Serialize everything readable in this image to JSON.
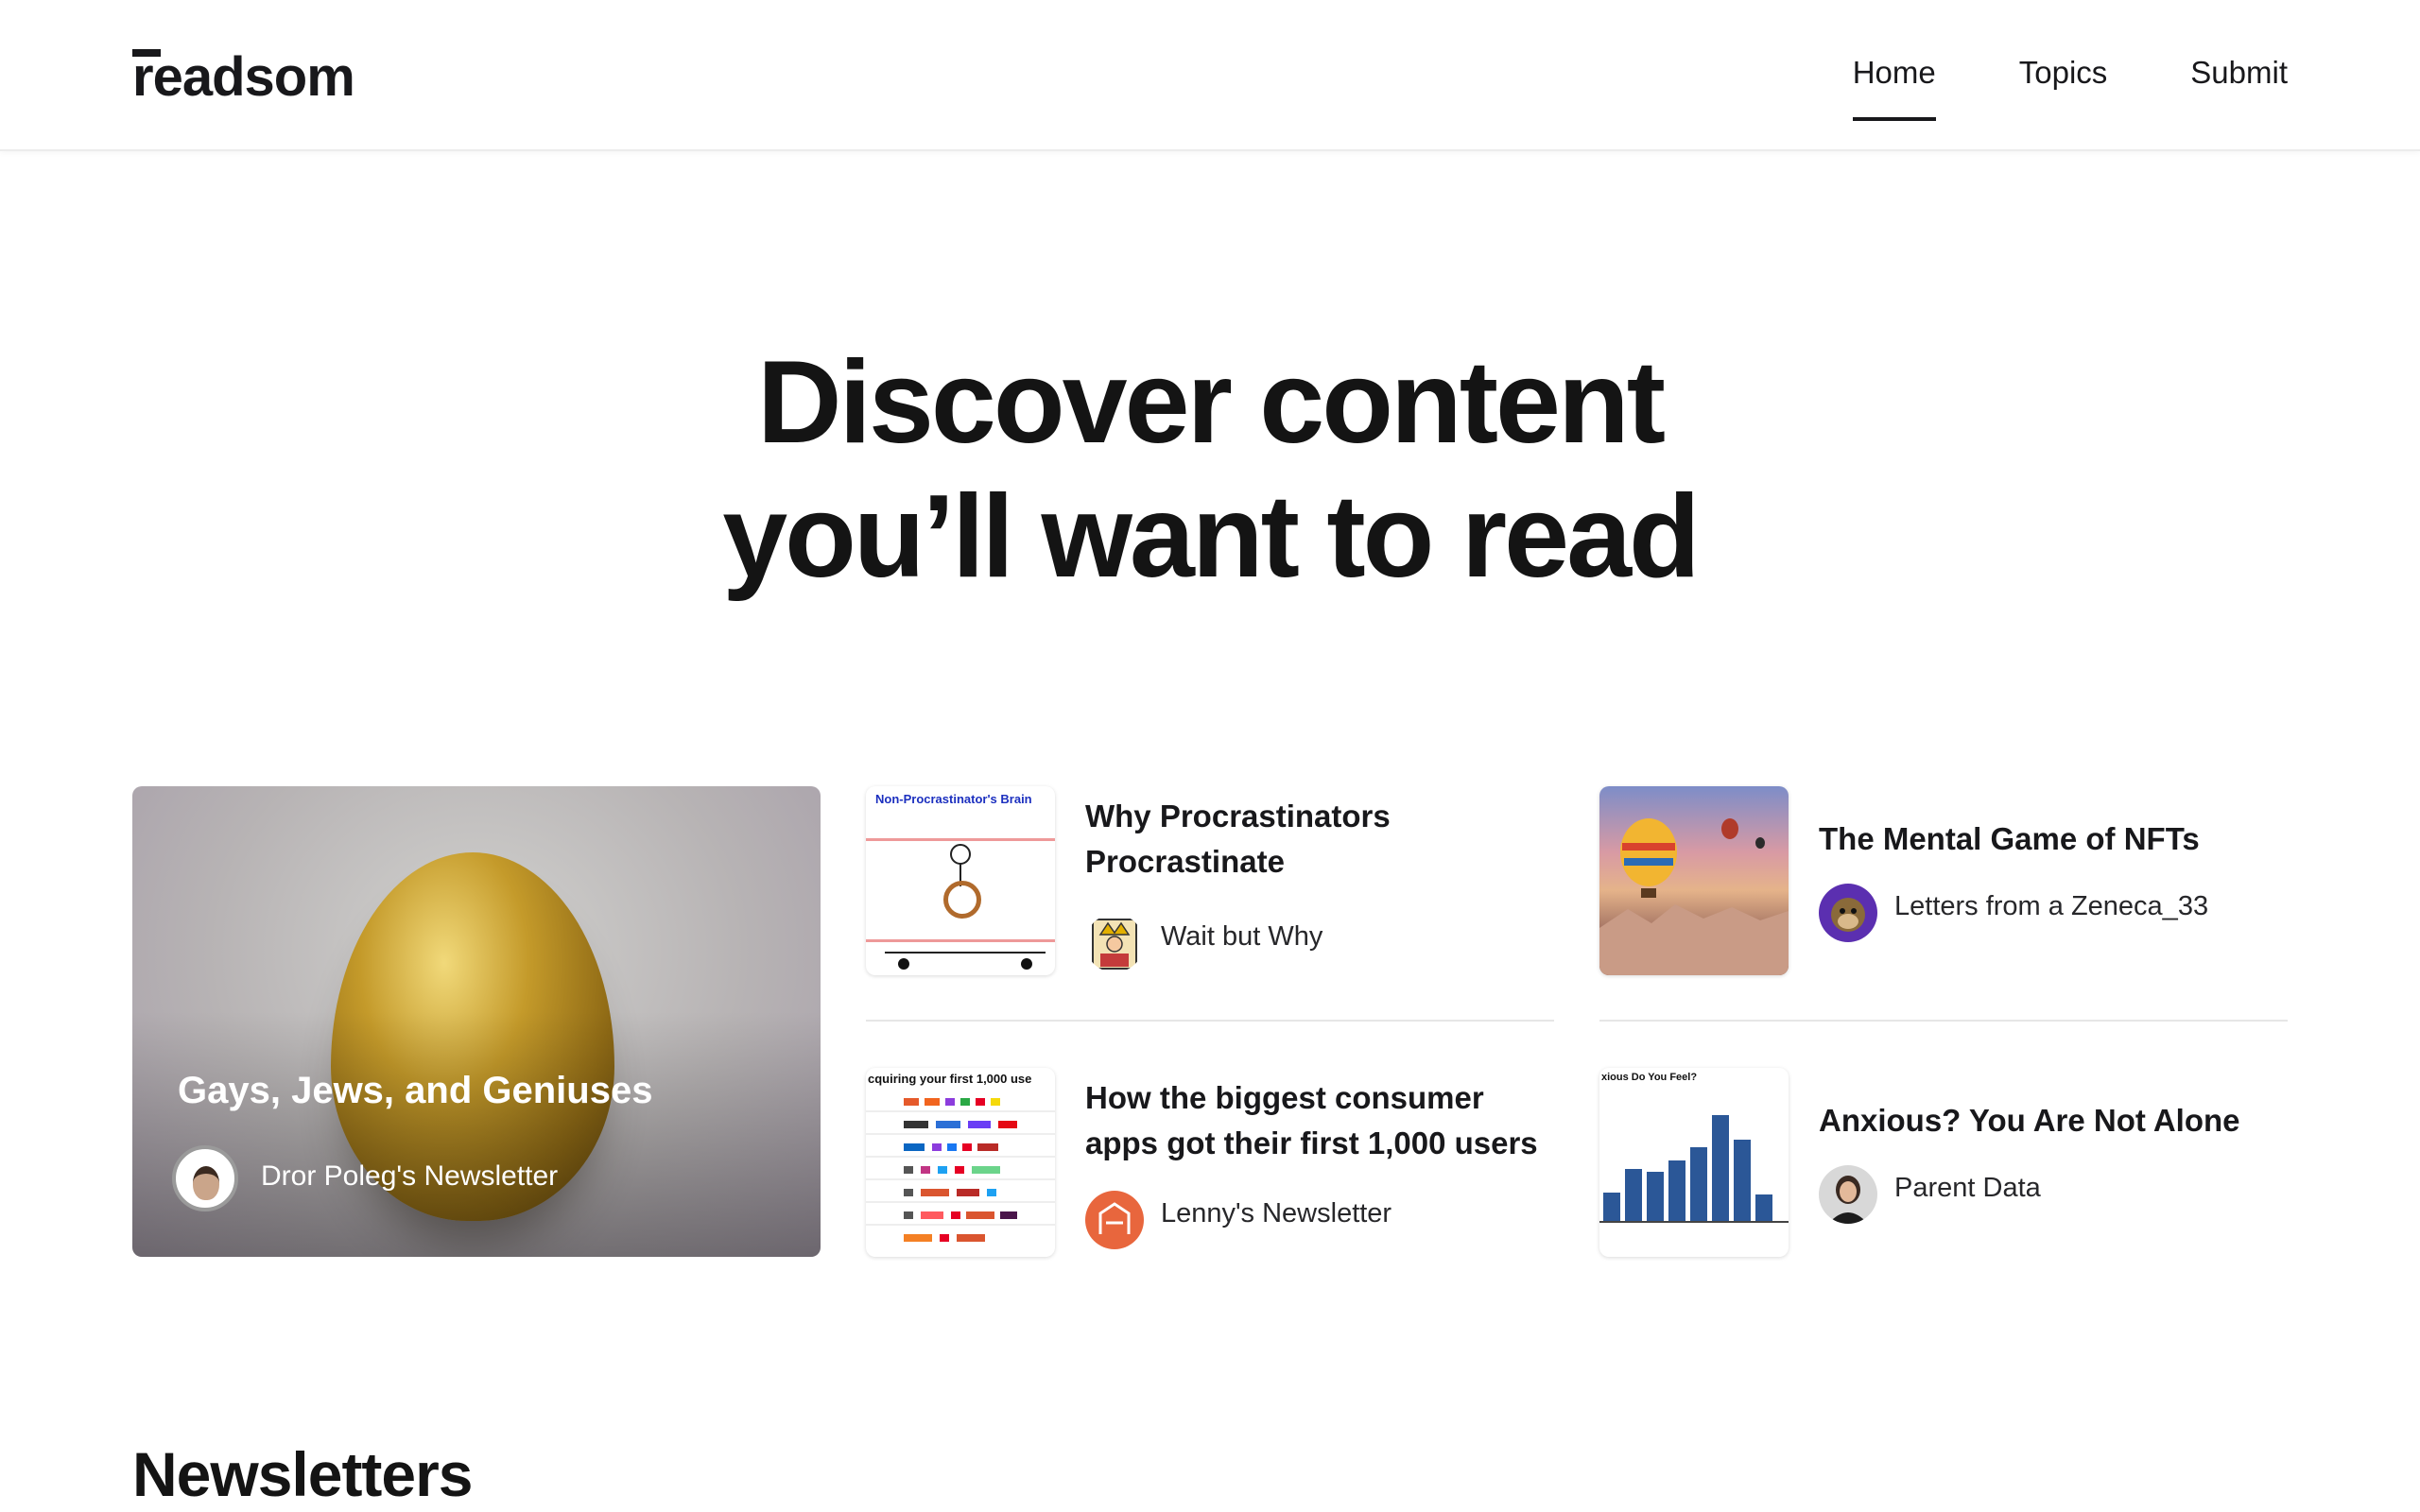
{
  "header": {
    "logo": "readsom",
    "nav": [
      {
        "label": "Home",
        "active": true
      },
      {
        "label": "Topics",
        "active": false
      },
      {
        "label": "Submit",
        "active": false
      }
    ]
  },
  "hero": {
    "line1": "Discover content",
    "line2": "you’ll want to read"
  },
  "featured": {
    "title": "Gays, Jews, and Geniuses",
    "source": "Dror Poleg's Newsletter"
  },
  "cards": [
    {
      "title": "Why Procrastinators Procrastinate",
      "source": "Wait but Why",
      "thumb_caption": "Non-Procrastinator's Brain"
    },
    {
      "title": "The Mental Game of NFTs",
      "source": "Letters from a Zeneca_33"
    },
    {
      "title": "How the biggest consumer apps got their first 1,000 users",
      "source": "Lenny's Newsletter",
      "thumb_caption": "cquiring your first 1,000 use"
    },
    {
      "title": "Anxious? You Are Not Alone",
      "source": "Parent Data",
      "thumb_caption": "xious Do You Feel?"
    }
  ],
  "sections": {
    "newsletters_title": "Newsletters"
  },
  "colors": {
    "text": "#18181b",
    "divider": "#e6e6e6",
    "accent_blue": "#2b5797"
  }
}
